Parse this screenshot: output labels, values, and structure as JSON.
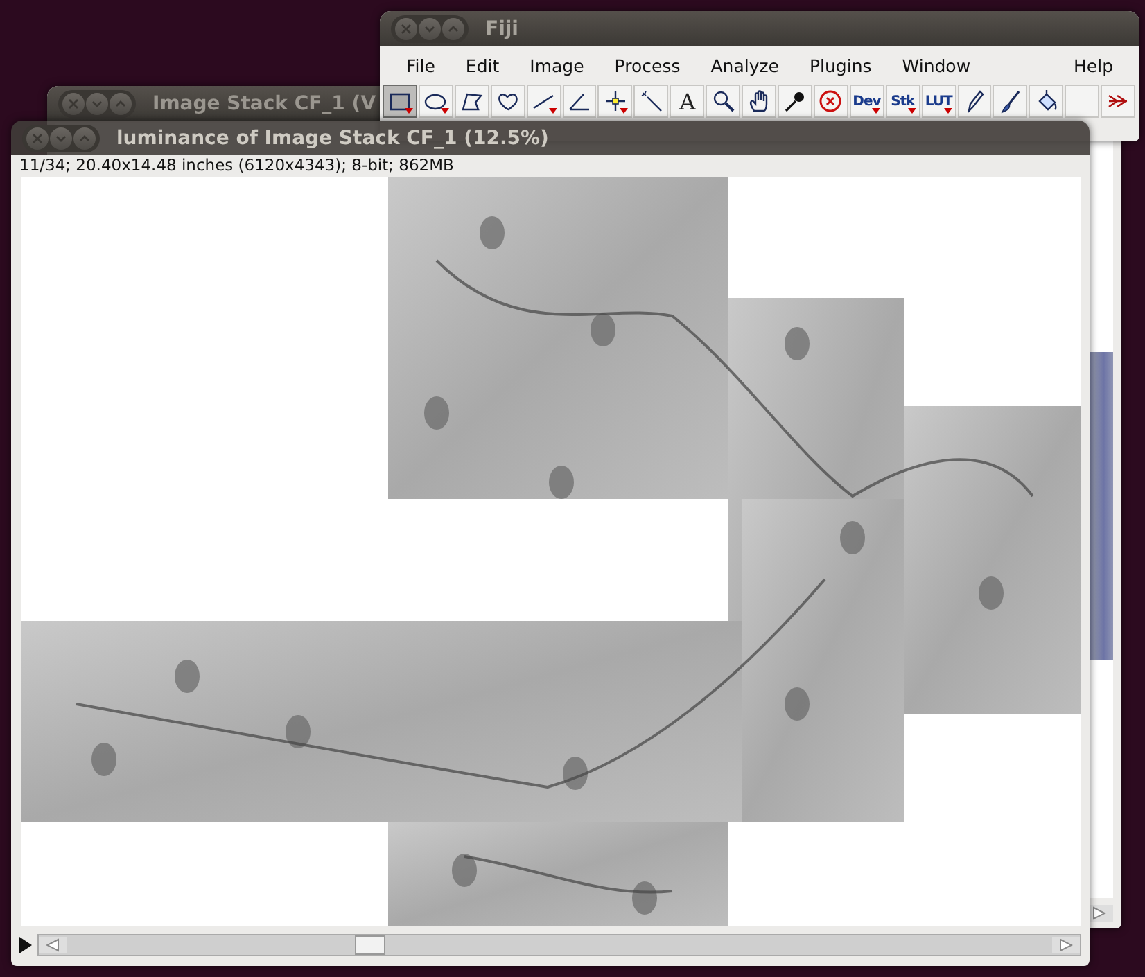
{
  "back_window": {
    "title": "Image Stack CF_1 (V"
  },
  "fiji": {
    "title": "Fiji",
    "menu": [
      "File",
      "Edit",
      "Image",
      "Process",
      "Analyze",
      "Plugins",
      "Window"
    ],
    "help": "Help",
    "tools": [
      {
        "kind": "rectangle",
        "selected": true,
        "has_menu": true
      },
      {
        "kind": "oval",
        "selected": false,
        "has_menu": true
      },
      {
        "kind": "polygon",
        "selected": false,
        "has_menu": false
      },
      {
        "kind": "freehand",
        "selected": false,
        "has_menu": false
      },
      {
        "kind": "line",
        "selected": false,
        "has_menu": true
      },
      {
        "kind": "angle",
        "selected": false,
        "has_menu": false
      },
      {
        "kind": "point",
        "selected": false,
        "has_menu": true
      },
      {
        "kind": "wand",
        "selected": false,
        "has_menu": false
      },
      {
        "kind": "text",
        "label": "A",
        "selected": false,
        "has_menu": false
      },
      {
        "kind": "zoom",
        "selected": false,
        "has_menu": false
      },
      {
        "kind": "hand",
        "selected": false,
        "has_menu": false
      },
      {
        "kind": "dropper",
        "selected": false,
        "has_menu": false
      },
      {
        "kind": "stop",
        "selected": false,
        "has_menu": false
      },
      {
        "kind": "label",
        "label": "Dev",
        "selected": false,
        "has_menu": true
      },
      {
        "kind": "label",
        "label": "Stk",
        "selected": false,
        "has_menu": true
      },
      {
        "kind": "label",
        "label": "LUT",
        "selected": false,
        "has_menu": true
      },
      {
        "kind": "pencil",
        "selected": false,
        "has_menu": false
      },
      {
        "kind": "brush",
        "selected": false,
        "has_menu": false
      },
      {
        "kind": "fill",
        "selected": false,
        "has_menu": false
      },
      {
        "kind": "blank",
        "selected": false,
        "has_menu": false
      },
      {
        "kind": "more",
        "selected": false,
        "has_menu": false
      }
    ]
  },
  "image_window": {
    "title": "luminance of Image Stack CF_1 (12.5%)",
    "info": "11/34; 20.40x14.48 inches (6120x4343); 8-bit; 862MB"
  }
}
